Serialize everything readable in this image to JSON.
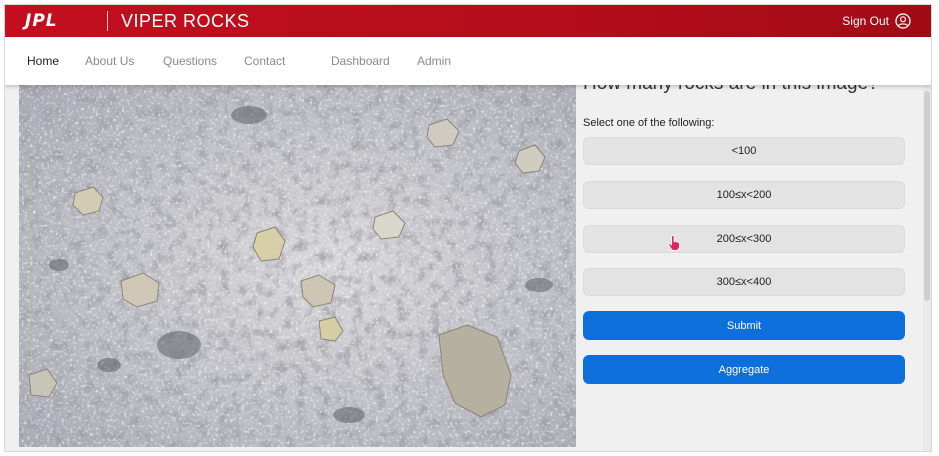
{
  "header": {
    "logo_text": "JPL",
    "app_title": "VIPER ROCKS",
    "sign_out_label": "Sign Out",
    "brand_color": "#c30f1f"
  },
  "nav": {
    "items": [
      {
        "label": "Home",
        "active": true
      },
      {
        "label": "About Us",
        "active": false
      },
      {
        "label": "Questions",
        "active": false
      },
      {
        "label": "Contact",
        "active": false
      },
      {
        "label": "Dashboard",
        "active": false
      },
      {
        "label": "Admin",
        "active": false
      }
    ]
  },
  "question": {
    "title": "How many rocks are in this image?",
    "prompt": "Select one of the following:",
    "options": [
      "<100",
      "100≤x<200",
      "200≤x<300",
      "300≤x<400"
    ]
  },
  "actions": {
    "submit_label": "Submit",
    "aggregate_label": "Aggregate",
    "button_color": "#0c6fdc"
  },
  "icons": {
    "user": "user-circle-icon",
    "cursor": "hand-pointer-icon"
  }
}
